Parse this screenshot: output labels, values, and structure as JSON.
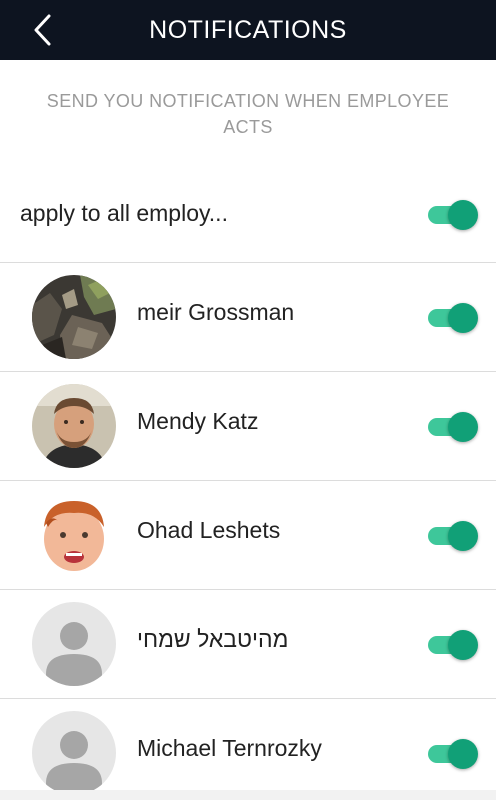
{
  "header": {
    "title": "NOTIFICATIONS",
    "back_icon": "chevron-left-icon"
  },
  "subtitle": "SEND YOU NOTIFICATION WHEN EMPLOYEE ACTS",
  "apply_all": {
    "label": "apply to all employ...",
    "enabled": true
  },
  "employees": [
    {
      "name": "meir Grossman",
      "avatar": "rocks-photo",
      "enabled": true
    },
    {
      "name": "Mendy Katz",
      "avatar": "man-photo",
      "enabled": true
    },
    {
      "name": "Ohad Leshets",
      "avatar": "child-photo",
      "enabled": true
    },
    {
      "name": "מהיטבאל שמחי",
      "avatar": "default-avatar",
      "enabled": true
    },
    {
      "name": "Michael Ternrozky",
      "avatar": "default-avatar",
      "enabled": true
    }
  ],
  "colors": {
    "header_bg": "#0d1420",
    "toggle_track": "#3ec79a",
    "toggle_knob": "#11a077",
    "subtitle": "#9a9a9a"
  }
}
